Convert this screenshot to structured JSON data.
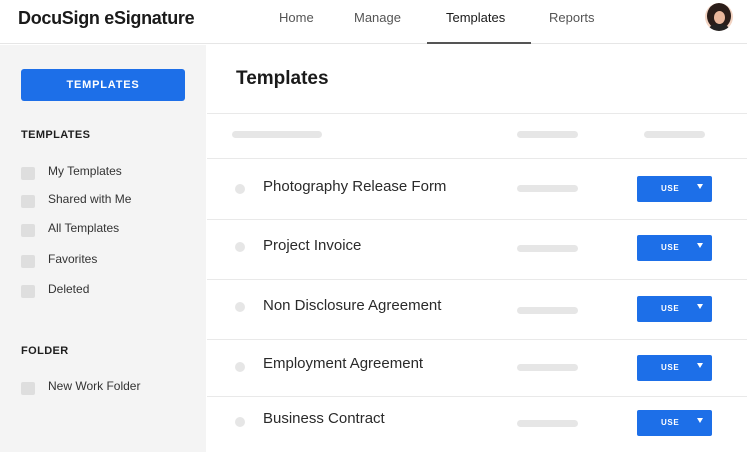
{
  "app": {
    "logo_text": "DocuSign eSignature"
  },
  "nav": {
    "items": [
      {
        "label": "Home"
      },
      {
        "label": "Manage"
      },
      {
        "label": "Templates",
        "active": true
      },
      {
        "label": "Reports"
      }
    ]
  },
  "sidebar": {
    "primary_button": "TEMPLATES",
    "templates_heading": "TEMPLATES",
    "template_items": [
      {
        "label": "My Templates"
      },
      {
        "label": "Shared with Me"
      },
      {
        "label": "All Templates"
      },
      {
        "label": "Favorites"
      },
      {
        "label": "Deleted"
      }
    ],
    "folder_heading": "FOLDER",
    "folder_items": [
      {
        "label": "New Work Folder"
      }
    ]
  },
  "main": {
    "title": "Templates",
    "rows": [
      {
        "name": "Photography Release Form",
        "action": "USE"
      },
      {
        "name": "Project Invoice",
        "action": "USE"
      },
      {
        "name": "Non Disclosure Agreement",
        "action": "USE"
      },
      {
        "name": "Employment Agreement",
        "action": "USE"
      },
      {
        "name": "Business Contract",
        "action": "USE"
      }
    ]
  },
  "colors": {
    "accent": "#1d6fe8",
    "sidebar_bg": "#f4f4f4",
    "placeholder": "#e6e6e6"
  }
}
